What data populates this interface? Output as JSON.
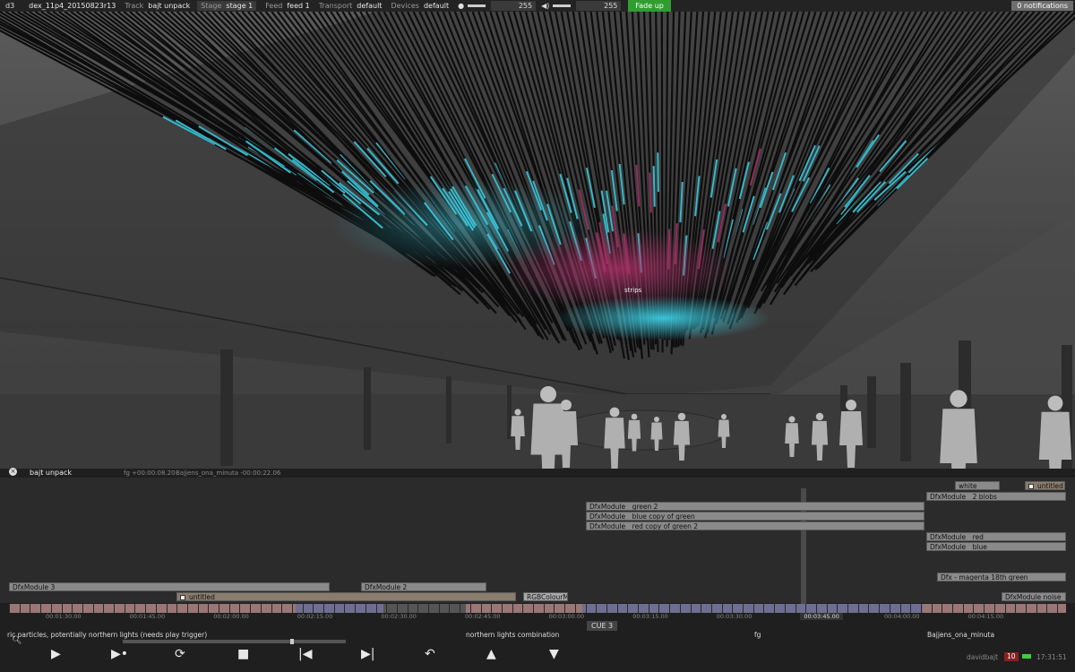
{
  "topbar": {
    "app": "d3",
    "project": "dex_11p4_20150823r13",
    "track_label": "Track",
    "track_value": "bajt unpack",
    "stage_label": "Stage",
    "stage_value": "stage 1",
    "feed_label": "Feed",
    "feed_value": "feed 1",
    "transport_label": "Transport",
    "transport_value": "default",
    "devices_label": "Devices",
    "devices_value": "default",
    "brightness_value": "255",
    "volume_value": "255",
    "fade_button": "Fade up",
    "notifications": "0 notifications"
  },
  "viewport": {
    "object_label": "strips",
    "accent_cyan": "#3fd6ec",
    "accent_magenta": "#b0306a"
  },
  "timeline": {
    "track_name": "bajt unpack",
    "fg_info": "fg +00:00:08.20",
    "bajjens_info": "Bajjens_ona_minuta -00:00:22.06",
    "layers": {
      "white": "white",
      "untitled_right": "untitled",
      "blobs": "DfxModule__2 blobs",
      "green2": "DfxModule__green 2",
      "blue_copy": "DfxModule__blue copy of green",
      "red_copy": "DfxModule__red copy of green 2",
      "red": "DfxModule__red",
      "blue": "DfxModule__blue",
      "magenta": "Dfx - magenta 18th green",
      "module3": "DfxModule 3",
      "module2": "DfxModule 2",
      "untitled_left": "untitled",
      "rgb": "RGBColourM",
      "noise": "DfxModule noise"
    },
    "timecodes": [
      "00:01:30.00",
      "00:01:45.00",
      "00:02:00.00",
      "00:02:15.00",
      "00:02:30.00",
      "00:02:45.00",
      "00:03:00.00",
      "00:03:15.00",
      "00:03:30.00",
      "00:03:45.00",
      "00:04:00.00",
      "00:04:15.00"
    ],
    "cue": "CUE 3",
    "cue_names": {
      "a": "ric particles, potentially northern lights (needs play trigger)",
      "b": "northern lights combination",
      "c": "fg",
      "d": "Bajjens_ona_minuta"
    },
    "transport_icons": [
      "play-icon",
      "play-to-end-icon",
      "loop-play-icon",
      "stop-icon",
      "previous-section-icon",
      "next-section-icon",
      "return-icon",
      "previous-cue-icon",
      "next-cue-icon"
    ],
    "status": {
      "user": "davidbajt",
      "badge": "10",
      "clock": "17:31:51"
    }
  }
}
